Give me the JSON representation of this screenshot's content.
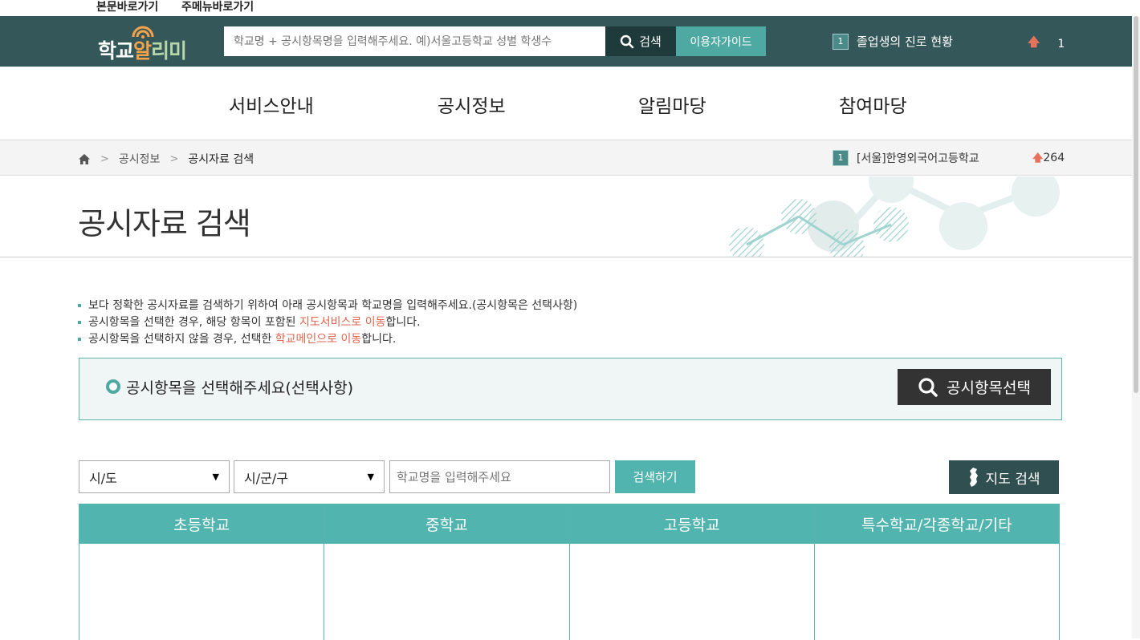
{
  "skip_links": [
    "본문바로가기",
    "주메뉴바로가기"
  ],
  "header": {
    "logo": "학교알리미",
    "search_placeholder": "학교명 + 공시항목명을 입력해주세요. 예)서울고등학교 성별 학생수",
    "search_button": "검색",
    "guide_button": "이용자가이드",
    "rank_number": "1",
    "rank_text": "졸업생의 진로 현황",
    "rank_count": "1"
  },
  "gnb": [
    "서비스안내",
    "공시정보",
    "알림마당",
    "참여마당"
  ],
  "breadcrumb": {
    "items": [
      "공시정보",
      "공시자료 검색"
    ],
    "rank_number": "1",
    "rank_text": "[서울]한영외국어고등학교",
    "rank_count": "264"
  },
  "page_title": "공시자료 검색",
  "notes": {
    "line1": "보다 정확한 공시자료를 검색하기 위하여 아래 공시항목과 학교명을 입력해주세요.(공시항목은 선택사항)",
    "line2_a": "공시항목을 선택한 경우, 해당 항목이 포함된 ",
    "line2_hl": "지도서비스로 이동",
    "line2_b": "합니다.",
    "line3_a": "공시항목을 선택하지 않을 경우, 선택한 ",
    "line3_hl": "학교메인으로 이동",
    "line3_b": "합니다."
  },
  "item_select": {
    "label": "공시항목을 선택해주세요(선택사항)",
    "button": "공시항목선택"
  },
  "filters": {
    "sido": "시/도",
    "sigungu": "시/군/구",
    "name_placeholder": "학교명을 입력해주세요",
    "search_button": "검색하기",
    "map_button": "지도 검색"
  },
  "categories": [
    "초등학교",
    "중학교",
    "고등학교",
    "특수학교/각종학교/기타"
  ],
  "colors": {
    "header_bg": "#34585a",
    "accent": "#52b4ae",
    "highlight": "#e2664e"
  }
}
